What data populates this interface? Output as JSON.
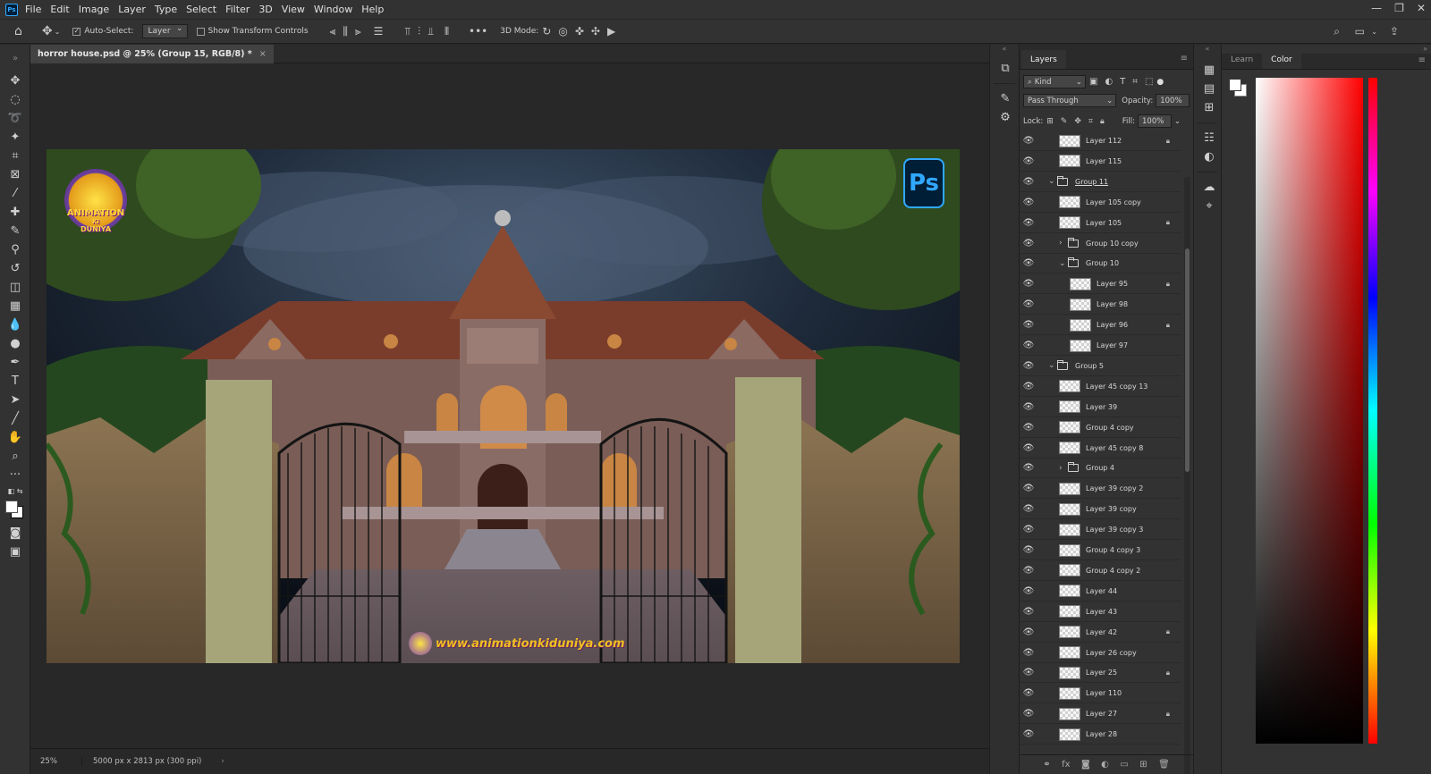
{
  "menu": {
    "items": [
      "File",
      "Edit",
      "Image",
      "Layer",
      "Type",
      "Select",
      "Filter",
      "3D",
      "View",
      "Window",
      "Help"
    ]
  },
  "options": {
    "auto_select_label": "Auto-Select:",
    "auto_select_value": "Layer",
    "transform_label": "Show Transform Controls",
    "mode_label": "3D Mode:"
  },
  "document": {
    "tab_title": "horror  house.psd @ 25% (Group 15, RGB/8) *",
    "zoom": "25%",
    "doc_info": "5000 px x 2813 px (300 ppi)"
  },
  "artwork": {
    "ps_badge": "Ps",
    "logo_line1": "ANIMATION",
    "logo_line2": "KI",
    "logo_line3": "DUNIYA",
    "website": "www.animationkiduniya.com"
  },
  "layers_panel": {
    "tab": "Layers",
    "filter_kind": "Kind",
    "blend_mode": "Pass Through",
    "opacity_label": "Opacity:",
    "opacity": "100%",
    "lock_label": "Lock:",
    "fill_label": "Fill:",
    "fill": "100%",
    "layers": [
      {
        "name": "Layer 112",
        "type": "layer",
        "indent": 2,
        "lock": true
      },
      {
        "name": "Layer 115",
        "type": "layer",
        "indent": 2,
        "lock": false
      },
      {
        "name": "Group 11",
        "type": "group",
        "indent": 1,
        "expanded": true,
        "lock": false
      },
      {
        "name": "Layer 105 copy",
        "type": "layer",
        "indent": 2,
        "lock": false
      },
      {
        "name": "Layer 105",
        "type": "layer",
        "indent": 2,
        "lock": true
      },
      {
        "name": "Group 10 copy",
        "type": "group",
        "indent": 2,
        "expanded": false,
        "lock": false
      },
      {
        "name": "Group 10",
        "type": "group",
        "indent": 2,
        "expanded": true,
        "lock": false
      },
      {
        "name": "Layer 95",
        "type": "layer",
        "indent": 3,
        "lock": true
      },
      {
        "name": "Layer 98",
        "type": "layer",
        "indent": 3,
        "lock": false
      },
      {
        "name": "Layer 96",
        "type": "layer",
        "indent": 3,
        "lock": true
      },
      {
        "name": "Layer 97",
        "type": "layer",
        "indent": 3,
        "lock": false
      },
      {
        "name": "Group 5",
        "type": "group",
        "indent": 1,
        "expanded": true,
        "lock": false
      },
      {
        "name": "Layer 45 copy 13",
        "type": "layer",
        "indent": 2,
        "lock": false
      },
      {
        "name": "Layer 39",
        "type": "layer",
        "indent": 2,
        "lock": false
      },
      {
        "name": "Group 4 copy",
        "type": "layer",
        "indent": 2,
        "lock": false
      },
      {
        "name": "Layer 45 copy 8",
        "type": "layer",
        "indent": 2,
        "lock": false
      },
      {
        "name": "Group 4",
        "type": "group",
        "indent": 2,
        "expanded": false,
        "lock": false
      },
      {
        "name": "Layer 39 copy 2",
        "type": "layer",
        "indent": 2,
        "lock": false
      },
      {
        "name": "Layer 39 copy",
        "type": "layer",
        "indent": 2,
        "lock": false
      },
      {
        "name": "Layer 39 copy 3",
        "type": "layer",
        "indent": 2,
        "lock": false
      },
      {
        "name": "Group 4 copy 3",
        "type": "layer",
        "indent": 2,
        "lock": false
      },
      {
        "name": "Group 4 copy 2",
        "type": "layer",
        "indent": 2,
        "lock": false
      },
      {
        "name": "Layer 44",
        "type": "layer",
        "indent": 2,
        "lock": false
      },
      {
        "name": "Layer 43",
        "type": "layer",
        "indent": 2,
        "lock": false
      },
      {
        "name": "Layer 42",
        "type": "layer",
        "indent": 2,
        "lock": true
      },
      {
        "name": "Layer 26 copy",
        "type": "layer",
        "indent": 2,
        "lock": false
      },
      {
        "name": "Layer 25",
        "type": "layer",
        "indent": 2,
        "lock": true
      },
      {
        "name": "Layer 110",
        "type": "layer",
        "indent": 2,
        "lock": false
      },
      {
        "name": "Layer 27",
        "type": "layer",
        "indent": 2,
        "lock": true
      },
      {
        "name": "Layer 28",
        "type": "layer",
        "indent": 2,
        "lock": false
      }
    ]
  },
  "color_panel": {
    "tabs": [
      "Learn",
      "Color"
    ],
    "active_tab": "Color"
  }
}
